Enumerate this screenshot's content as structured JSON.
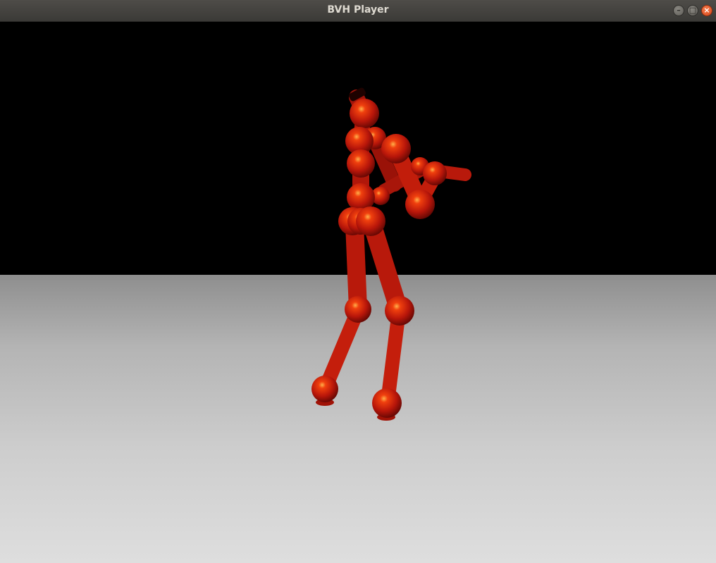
{
  "window": {
    "title": "BVH Player"
  },
  "controls": {
    "minimize_glyph": "–",
    "maximize_glyph": "□",
    "close_glyph": "×"
  },
  "scene": {
    "sky_color": "#000000",
    "floor_color": "#c8c8c8",
    "figure_color": "#cc1a0a"
  }
}
